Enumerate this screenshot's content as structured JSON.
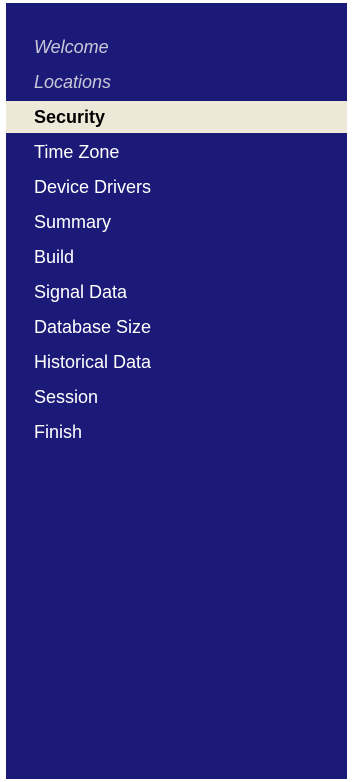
{
  "sidebar": {
    "background": "#1c1a78",
    "active_background": "#ece9d8",
    "items": [
      {
        "label": "Welcome",
        "state": "visited"
      },
      {
        "label": "Locations",
        "state": "visited"
      },
      {
        "label": "Security",
        "state": "active"
      },
      {
        "label": "Time Zone",
        "state": "pending"
      },
      {
        "label": "Device Drivers",
        "state": "pending"
      },
      {
        "label": "Summary",
        "state": "pending"
      },
      {
        "label": "Build",
        "state": "pending"
      },
      {
        "label": "Signal Data",
        "state": "pending"
      },
      {
        "label": "Database Size",
        "state": "pending"
      },
      {
        "label": "Historical Data",
        "state": "pending"
      },
      {
        "label": "Session",
        "state": "pending"
      },
      {
        "label": "Finish",
        "state": "pending"
      }
    ]
  }
}
